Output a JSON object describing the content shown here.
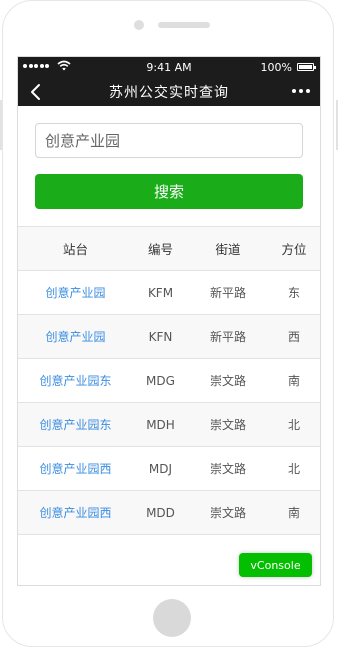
{
  "status_bar": {
    "time": "9:41 AM",
    "battery": "100%"
  },
  "nav": {
    "title": "苏州公交实时查询",
    "back_icon": "chevron-left-icon",
    "more_icon": "more-dots-icon"
  },
  "search": {
    "value": "创意产业园",
    "button_label": "搜索"
  },
  "table": {
    "headers": [
      "站台",
      "编号",
      "街道",
      "方位"
    ],
    "rows": [
      [
        "创意产业园",
        "KFM",
        "新平路",
        "东"
      ],
      [
        "创意产业园",
        "KFN",
        "新平路",
        "西"
      ],
      [
        "创意产业园东",
        "MDG",
        "崇文路",
        "南"
      ],
      [
        "创意产业园东",
        "MDH",
        "崇文路",
        "北"
      ],
      [
        "创意产业园西",
        "MDJ",
        "崇文路",
        "北"
      ],
      [
        "创意产业园西",
        "MDD",
        "崇文路",
        "南"
      ]
    ]
  },
  "vconsole_label": "vConsole",
  "colors": {
    "nav_background": "#1c1c1c",
    "primary_button": "#1aad19",
    "link": "#3b8de0",
    "vconsole": "#04be02"
  }
}
